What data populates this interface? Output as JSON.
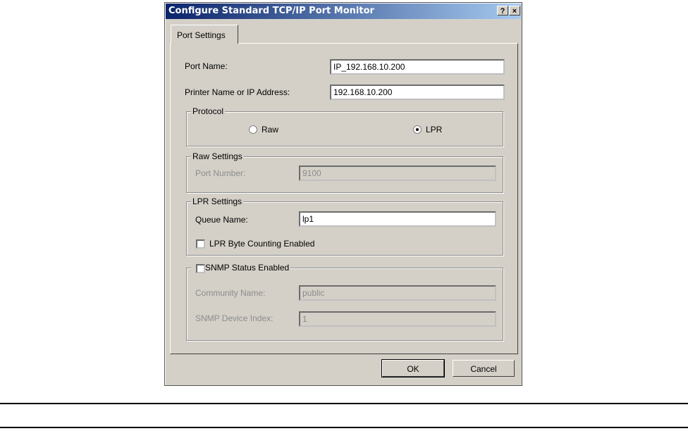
{
  "window": {
    "title": "Configure Standard TCP/IP Port Monitor",
    "help_label": "?",
    "close_label": "×"
  },
  "tabs": [
    {
      "label": "Port Settings"
    }
  ],
  "fields": {
    "port_name": {
      "label": "Port Name:",
      "value": "IP_192.168.10.200"
    },
    "printer_address": {
      "label": "Printer Name or IP Address:",
      "value": "192.168.10.200"
    }
  },
  "protocol": {
    "legend": "Protocol",
    "options": [
      {
        "label": "Raw",
        "selected": false
      },
      {
        "label": "LPR",
        "selected": true
      }
    ]
  },
  "raw_settings": {
    "legend": "Raw Settings",
    "port_number_label": "Port Number:",
    "port_number_value": "9100"
  },
  "lpr_settings": {
    "legend": "LPR Settings",
    "queue_name_label": "Queue Name:",
    "queue_name_value": "lp1",
    "byte_counting_label": "LPR Byte Counting Enabled",
    "byte_counting_checked": false
  },
  "snmp": {
    "legend": "SNMP Status Enabled",
    "enabled": false,
    "community_label": "Community Name:",
    "community_value": "public",
    "device_index_label": "SNMP Device Index:",
    "device_index_value": "1"
  },
  "buttons": {
    "ok": "OK",
    "cancel": "Cancel"
  }
}
